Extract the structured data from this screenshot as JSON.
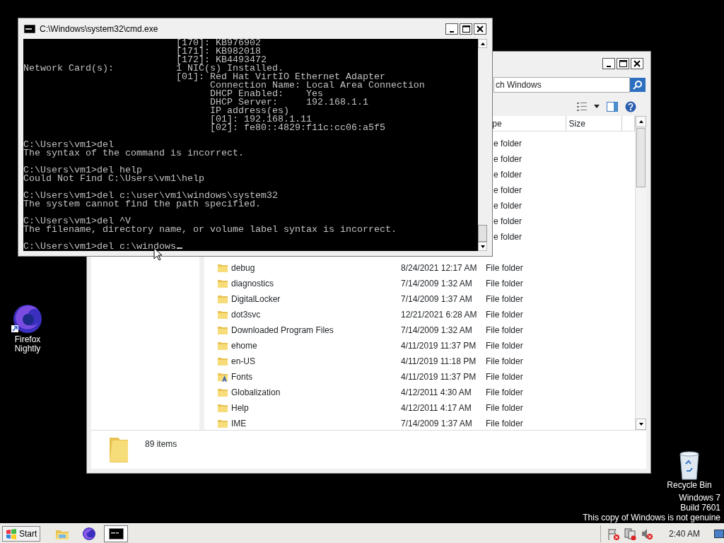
{
  "cmd_window": {
    "title": "C:\\Windows\\system32\\cmd.exe",
    "blocks": [
      [
        "                           [170]: KB976902",
        "                           [171]: KB982018",
        "                           [172]: KB4493472",
        "Network Card(s):           1 NIC(s) Installed.",
        "                           [01]: Red Hat VirtIO Ethernet Adapter",
        "                                 Connection Name: Local Area Connection",
        "                                 DHCP Enabled:    Yes",
        "                                 DHCP Server:     192.168.1.1",
        "                                 IP address(es)",
        "                                 [01]: 192.168.1.11",
        "                                 [02]: fe80::4829:f11c:cc06:a5f5"
      ],
      [
        "C:\\Users\\vm1>del",
        "The syntax of the command is incorrect."
      ],
      [
        "C:\\Users\\vm1>del help",
        "Could Not Find C:\\Users\\vm1\\help"
      ],
      [
        "C:\\Users\\vm1>del c:\\user\\vm1\\windows\\system32",
        "The system cannot find the path specified."
      ],
      [
        "C:\\Users\\vm1>del ^V",
        "The filename, directory name, or volume label syntax is incorrect."
      ],
      [
        "C:\\Users\\vm1>del c:\\windows"
      ]
    ]
  },
  "explorer_window": {
    "search": {
      "placeholder": "ch Windows"
    },
    "columns": [
      {
        "label": "pe"
      },
      {
        "label": "Size"
      }
    ],
    "rows": [
      {
        "kind": "clipped",
        "type": "e folder"
      },
      {
        "kind": "clipped",
        "type": "e folder"
      },
      {
        "kind": "clipped",
        "type": "e folder"
      },
      {
        "kind": "clipped",
        "type": "e folder"
      },
      {
        "kind": "clipped",
        "type": "e folder"
      },
      {
        "kind": "clipped",
        "type": "e folder"
      },
      {
        "kind": "clipped",
        "type": "e folder"
      },
      {
        "kind": "folder",
        "name": "debug",
        "date": "8/24/2021 12:17 AM",
        "type": "File folder"
      },
      {
        "kind": "folder",
        "name": "diagnostics",
        "date": "7/14/2009 1:32 AM",
        "type": "File folder"
      },
      {
        "kind": "folder",
        "name": "DigitalLocker",
        "date": "7/14/2009 1:37 AM",
        "type": "File folder"
      },
      {
        "kind": "folder",
        "name": "dot3svc",
        "date": "12/21/2021 6:28 AM",
        "type": "File folder"
      },
      {
        "kind": "folder",
        "name": "Downloaded Program Files",
        "date": "7/14/2009 1:32 AM",
        "type": "File folder"
      },
      {
        "kind": "folder",
        "name": "ehome",
        "date": "4/11/2019 11:37 PM",
        "type": "File folder"
      },
      {
        "kind": "folder",
        "name": "en-US",
        "date": "4/11/2019 11:18 PM",
        "type": "File folder"
      },
      {
        "kind": "fonts",
        "name": "Fonts",
        "date": "4/11/2019 11:37 PM",
        "type": "File folder"
      },
      {
        "kind": "folder",
        "name": "Globalization",
        "date": "4/12/2011 4:30 AM",
        "type": "File folder"
      },
      {
        "kind": "folder",
        "name": "Help",
        "date": "4/12/2011 4:17 AM",
        "type": "File folder"
      },
      {
        "kind": "folder",
        "name": "IME",
        "date": "7/14/2009 1:37 AM",
        "type": "File folder"
      }
    ],
    "item_count": "89 items"
  },
  "desktop_icons": [
    {
      "kind": "firefox",
      "label": "Firefox Nightly"
    },
    {
      "kind": "recycle_bin",
      "label": "Recycle Bin"
    }
  ],
  "os_notice": [
    "Windows 7",
    "Build 7601",
    "This copy of Windows is not genuine"
  ],
  "taskbar": {
    "start": "Start",
    "apps": [
      {
        "kind": "explorer",
        "selected": false
      },
      {
        "kind": "firefox",
        "selected": false
      },
      {
        "kind": "cmd",
        "selected": true
      }
    ],
    "clock": "2:40 AM"
  }
}
